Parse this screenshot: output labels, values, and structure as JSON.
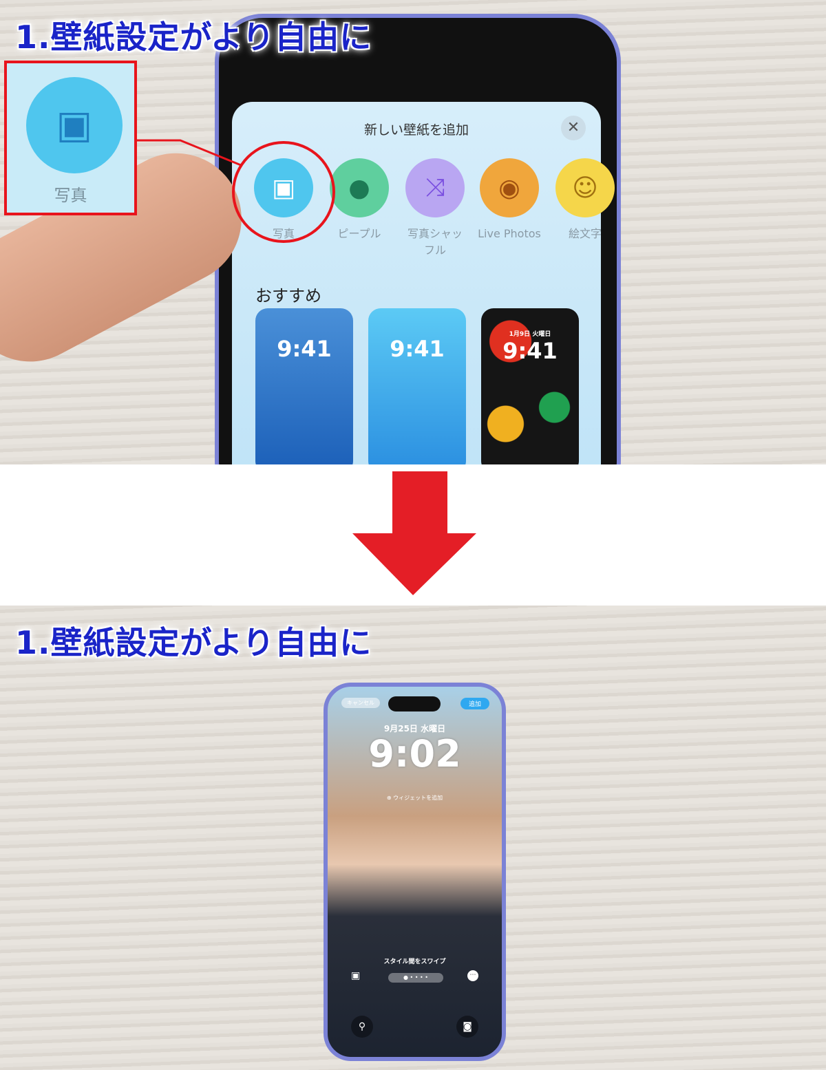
{
  "caption": "1.壁紙設定がより自由に",
  "top": {
    "sheet_title": "新しい壁紙を追加",
    "close_icon": "close-icon",
    "options": [
      {
        "label": "写真",
        "icon": "photos-icon",
        "color": "#4fc6ee"
      },
      {
        "label": "ピープル",
        "icon": "person-icon",
        "color": "#5fcf9e"
      },
      {
        "label": "写真シャッフル",
        "icon": "shuffle-icon",
        "color": "#b9a6f2"
      },
      {
        "label": "Live Photos",
        "icon": "play-icon",
        "color": "#f0a63c"
      },
      {
        "label": "絵文字",
        "icon": "emoji-icon",
        "color": "#f5d64a"
      }
    ],
    "recommended_heading": "おすすめ",
    "cards": [
      {
        "time": "9:41"
      },
      {
        "time": "9:41"
      },
      {
        "time": "9:41",
        "date": "1月9日 火曜日"
      }
    ],
    "inset_label": "写真",
    "highlight_color": "#e8141c"
  },
  "arrow_color": "#e41e26",
  "bottom": {
    "cancel": "キャンセル",
    "add": "追加",
    "date": "9月25日 水曜日",
    "time": "9:02",
    "add_widget": "ウィジェットを追加",
    "swipe_hint": "スタイル間をスワイプ"
  }
}
